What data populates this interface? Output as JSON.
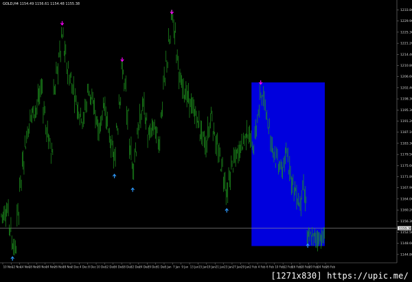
{
  "header": {
    "symbol": "GOLD,H4",
    "quote": "1154.49  1156.61  1154.48  1155.38"
  },
  "price_axis": {
    "ticks": [
      "1233.80",
      "1229.90",
      "1225.30",
      "1221.20",
      "1214.40",
      "1210.80",
      "1206.60",
      "1202.40",
      "1198.30",
      "1195.30",
      "1191.20",
      "1187.10",
      "1183.30",
      "1179.50",
      "1175.60",
      "1171.80",
      "1167.90",
      "1164.00",
      "1160.20",
      "1156.30",
      "1152.50",
      "1148.60",
      "1144.80"
    ],
    "current_price": "1155.38"
  },
  "time_axis": {
    "labels": [
      "10 Nov",
      "12 Nov",
      "14 Nov",
      "18 Nov",
      "20 Nov",
      "24 Nov",
      "26 Nov",
      "28 Nov",
      "2 Dec",
      "4 Dec",
      "8 Dec",
      "10 Dec",
      "12 Dec",
      "16 Dec",
      "18 Dec",
      "22 Dec",
      "24 Dec",
      "29 Dec",
      "31 Dec",
      "5 Jan",
      "7 Jan",
      "9 Jan",
      "13 Jan",
      "15 Jan",
      "19 Jan",
      "21 Jan",
      "23 Jan",
      "27 Jan",
      "29 Jan",
      "2 Feb",
      "4 Feb",
      "6 Feb",
      "10 Feb",
      "12 Feb",
      "16 Feb",
      "18 Feb",
      "20 Feb",
      "24 Feb",
      "26 Feb"
    ]
  },
  "colors": {
    "background": "#000000",
    "candles": "#1f9a1f",
    "highlight_box": "#0000dd",
    "sell_arrow": "#ff00ff",
    "buy_arrow": "#2e9bff",
    "price_line": "#9a9a9a"
  },
  "arrows": [
    {
      "type": "buy-arrow-icon",
      "bar": 4,
      "price": 1145.0
    },
    {
      "type": "sell-arrow-icon",
      "bar": 23,
      "price": 1228.2
    },
    {
      "type": "sell-arrow-icon",
      "bar": 46,
      "price": 1215.2
    },
    {
      "type": "buy-arrow-icon",
      "bar": 43,
      "price": 1174.5
    },
    {
      "type": "buy-arrow-icon",
      "bar": 50,
      "price": 1169.6
    },
    {
      "type": "sell-arrow-icon",
      "bar": 65,
      "price": 1232.2
    },
    {
      "type": "buy-arrow-icon",
      "bar": 86,
      "price": 1162.2
    },
    {
      "type": "sell-arrow-icon",
      "bar": 99,
      "price": 1207.0
    },
    {
      "type": "buy-arrow-icon",
      "bar": 117,
      "price": 1149.6
    }
  ],
  "series_anchors": [
    [
      0,
      1160
    ],
    [
      2,
      1162
    ],
    [
      4,
      1150
    ],
    [
      5,
      1148
    ],
    [
      7,
      1172
    ],
    [
      9,
      1186
    ],
    [
      11,
      1196
    ],
    [
      13,
      1198
    ],
    [
      15,
      1206
    ],
    [
      17,
      1190
    ],
    [
      19,
      1183
    ],
    [
      20,
      1205
    ],
    [
      22,
      1218
    ],
    [
      23,
      1224
    ],
    [
      25,
      1212
    ],
    [
      27,
      1206
    ],
    [
      29,
      1198
    ],
    [
      31,
      1194
    ],
    [
      33,
      1205
    ],
    [
      35,
      1199
    ],
    [
      37,
      1190
    ],
    [
      39,
      1200
    ],
    [
      41,
      1188
    ],
    [
      43,
      1180
    ],
    [
      44,
      1192
    ],
    [
      46,
      1212
    ],
    [
      47,
      1206
    ],
    [
      49,
      1184
    ],
    [
      50,
      1177
    ],
    [
      52,
      1190
    ],
    [
      54,
      1200
    ],
    [
      56,
      1188
    ],
    [
      58,
      1192
    ],
    [
      60,
      1186
    ],
    [
      62,
      1208
    ],
    [
      64,
      1222
    ],
    [
      65,
      1231
    ],
    [
      66,
      1226
    ],
    [
      68,
      1208
    ],
    [
      70,
      1204
    ],
    [
      72,
      1200
    ],
    [
      74,
      1196
    ],
    [
      76,
      1190
    ],
    [
      78,
      1185
    ],
    [
      80,
      1196
    ],
    [
      82,
      1185
    ],
    [
      84,
      1178
    ],
    [
      86,
      1168
    ],
    [
      88,
      1178
    ],
    [
      90,
      1182
    ],
    [
      92,
      1186
    ],
    [
      94,
      1190
    ],
    [
      96,
      1184
    ],
    [
      98,
      1196
    ],
    [
      99,
      1204
    ],
    [
      101,
      1198
    ],
    [
      103,
      1186
    ],
    [
      105,
      1180
    ],
    [
      107,
      1176
    ],
    [
      109,
      1182
    ],
    [
      111,
      1172
    ],
    [
      113,
      1166
    ],
    [
      114,
      1164
    ],
    [
      115,
      1170
    ],
    [
      116,
      1166
    ],
    [
      117,
      1152
    ]
  ],
  "highlight_box": {
    "bar_from": 96,
    "bar_to": 123,
    "price_top": 1207.5,
    "price_bottom": 1149.0
  },
  "watermark": "[1271x830] https://upic.me/"
}
